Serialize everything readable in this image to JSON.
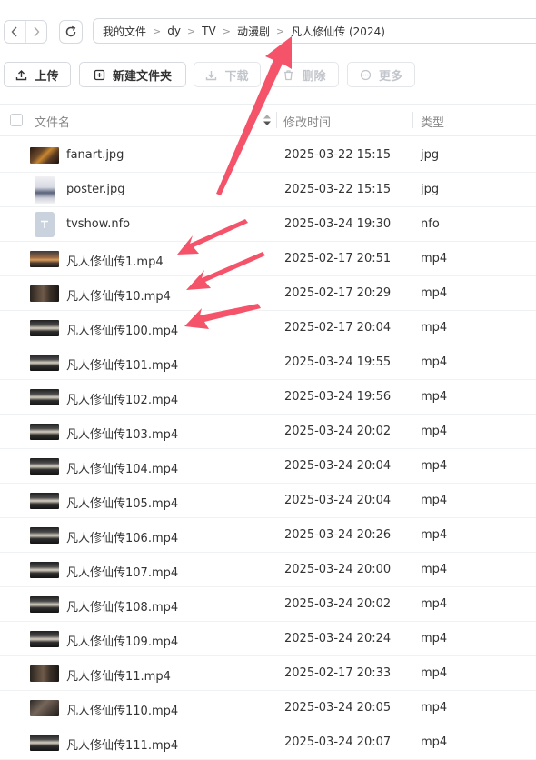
{
  "breadcrumb": [
    "我的文件",
    "dy",
    "TV",
    "动漫剧",
    "凡人修仙传 (2024)"
  ],
  "toolbar": {
    "upload": "上传",
    "new_folder": "新建文件夹",
    "download": "下载",
    "delete": "删除",
    "more": "更多"
  },
  "table": {
    "columns": {
      "name": "文件名",
      "modified": "修改时间",
      "type": "类型"
    },
    "rows": [
      {
        "name": "fanart.jpg",
        "modified": "2025-03-22 15:15",
        "type": "jpg",
        "thumb": "fanart-image"
      },
      {
        "name": "poster.jpg",
        "modified": "2025-03-22 15:15",
        "type": "jpg",
        "thumb": "poster-image"
      },
      {
        "name": "tvshow.nfo",
        "modified": "2025-03-24 19:30",
        "type": "nfo",
        "thumb": "text-file-icon"
      },
      {
        "name": "凡人修仙传1.mp4",
        "modified": "2025-02-17 20:51",
        "type": "mp4",
        "thumb": "video-thumbnail"
      },
      {
        "name": "凡人修仙传10.mp4",
        "modified": "2025-02-17 20:29",
        "type": "mp4",
        "thumb": "video-thumbnail"
      },
      {
        "name": "凡人修仙传100.mp4",
        "modified": "2025-02-17 20:04",
        "type": "mp4",
        "thumb": "video-thumbnail"
      },
      {
        "name": "凡人修仙传101.mp4",
        "modified": "2025-03-24 19:55",
        "type": "mp4",
        "thumb": "video-thumbnail"
      },
      {
        "name": "凡人修仙传102.mp4",
        "modified": "2025-03-24 19:56",
        "type": "mp4",
        "thumb": "video-thumbnail"
      },
      {
        "name": "凡人修仙传103.mp4",
        "modified": "2025-03-24 20:02",
        "type": "mp4",
        "thumb": "video-thumbnail"
      },
      {
        "name": "凡人修仙传104.mp4",
        "modified": "2025-03-24 20:04",
        "type": "mp4",
        "thumb": "video-thumbnail"
      },
      {
        "name": "凡人修仙传105.mp4",
        "modified": "2025-03-24 20:04",
        "type": "mp4",
        "thumb": "video-thumbnail"
      },
      {
        "name": "凡人修仙传106.mp4",
        "modified": "2025-03-24 20:26",
        "type": "mp4",
        "thumb": "video-thumbnail"
      },
      {
        "name": "凡人修仙传107.mp4",
        "modified": "2025-03-24 20:00",
        "type": "mp4",
        "thumb": "video-thumbnail"
      },
      {
        "name": "凡人修仙传108.mp4",
        "modified": "2025-03-24 20:02",
        "type": "mp4",
        "thumb": "video-thumbnail"
      },
      {
        "name": "凡人修仙传109.mp4",
        "modified": "2025-03-24 20:24",
        "type": "mp4",
        "thumb": "video-thumbnail"
      },
      {
        "name": "凡人修仙传11.mp4",
        "modified": "2025-02-17 20:33",
        "type": "mp4",
        "thumb": "video-thumbnail"
      },
      {
        "name": "凡人修仙传110.mp4",
        "modified": "2025-03-24 20:05",
        "type": "mp4",
        "thumb": "video-thumbnail"
      },
      {
        "name": "凡人修仙传111.mp4",
        "modified": "2025-03-24 20:07",
        "type": "mp4",
        "thumb": "video-thumbnail"
      }
    ]
  },
  "colors": {
    "annotation_arrow": "#f4536a",
    "border": "#d6d9de",
    "disabled_text": "#c2c6cc"
  }
}
